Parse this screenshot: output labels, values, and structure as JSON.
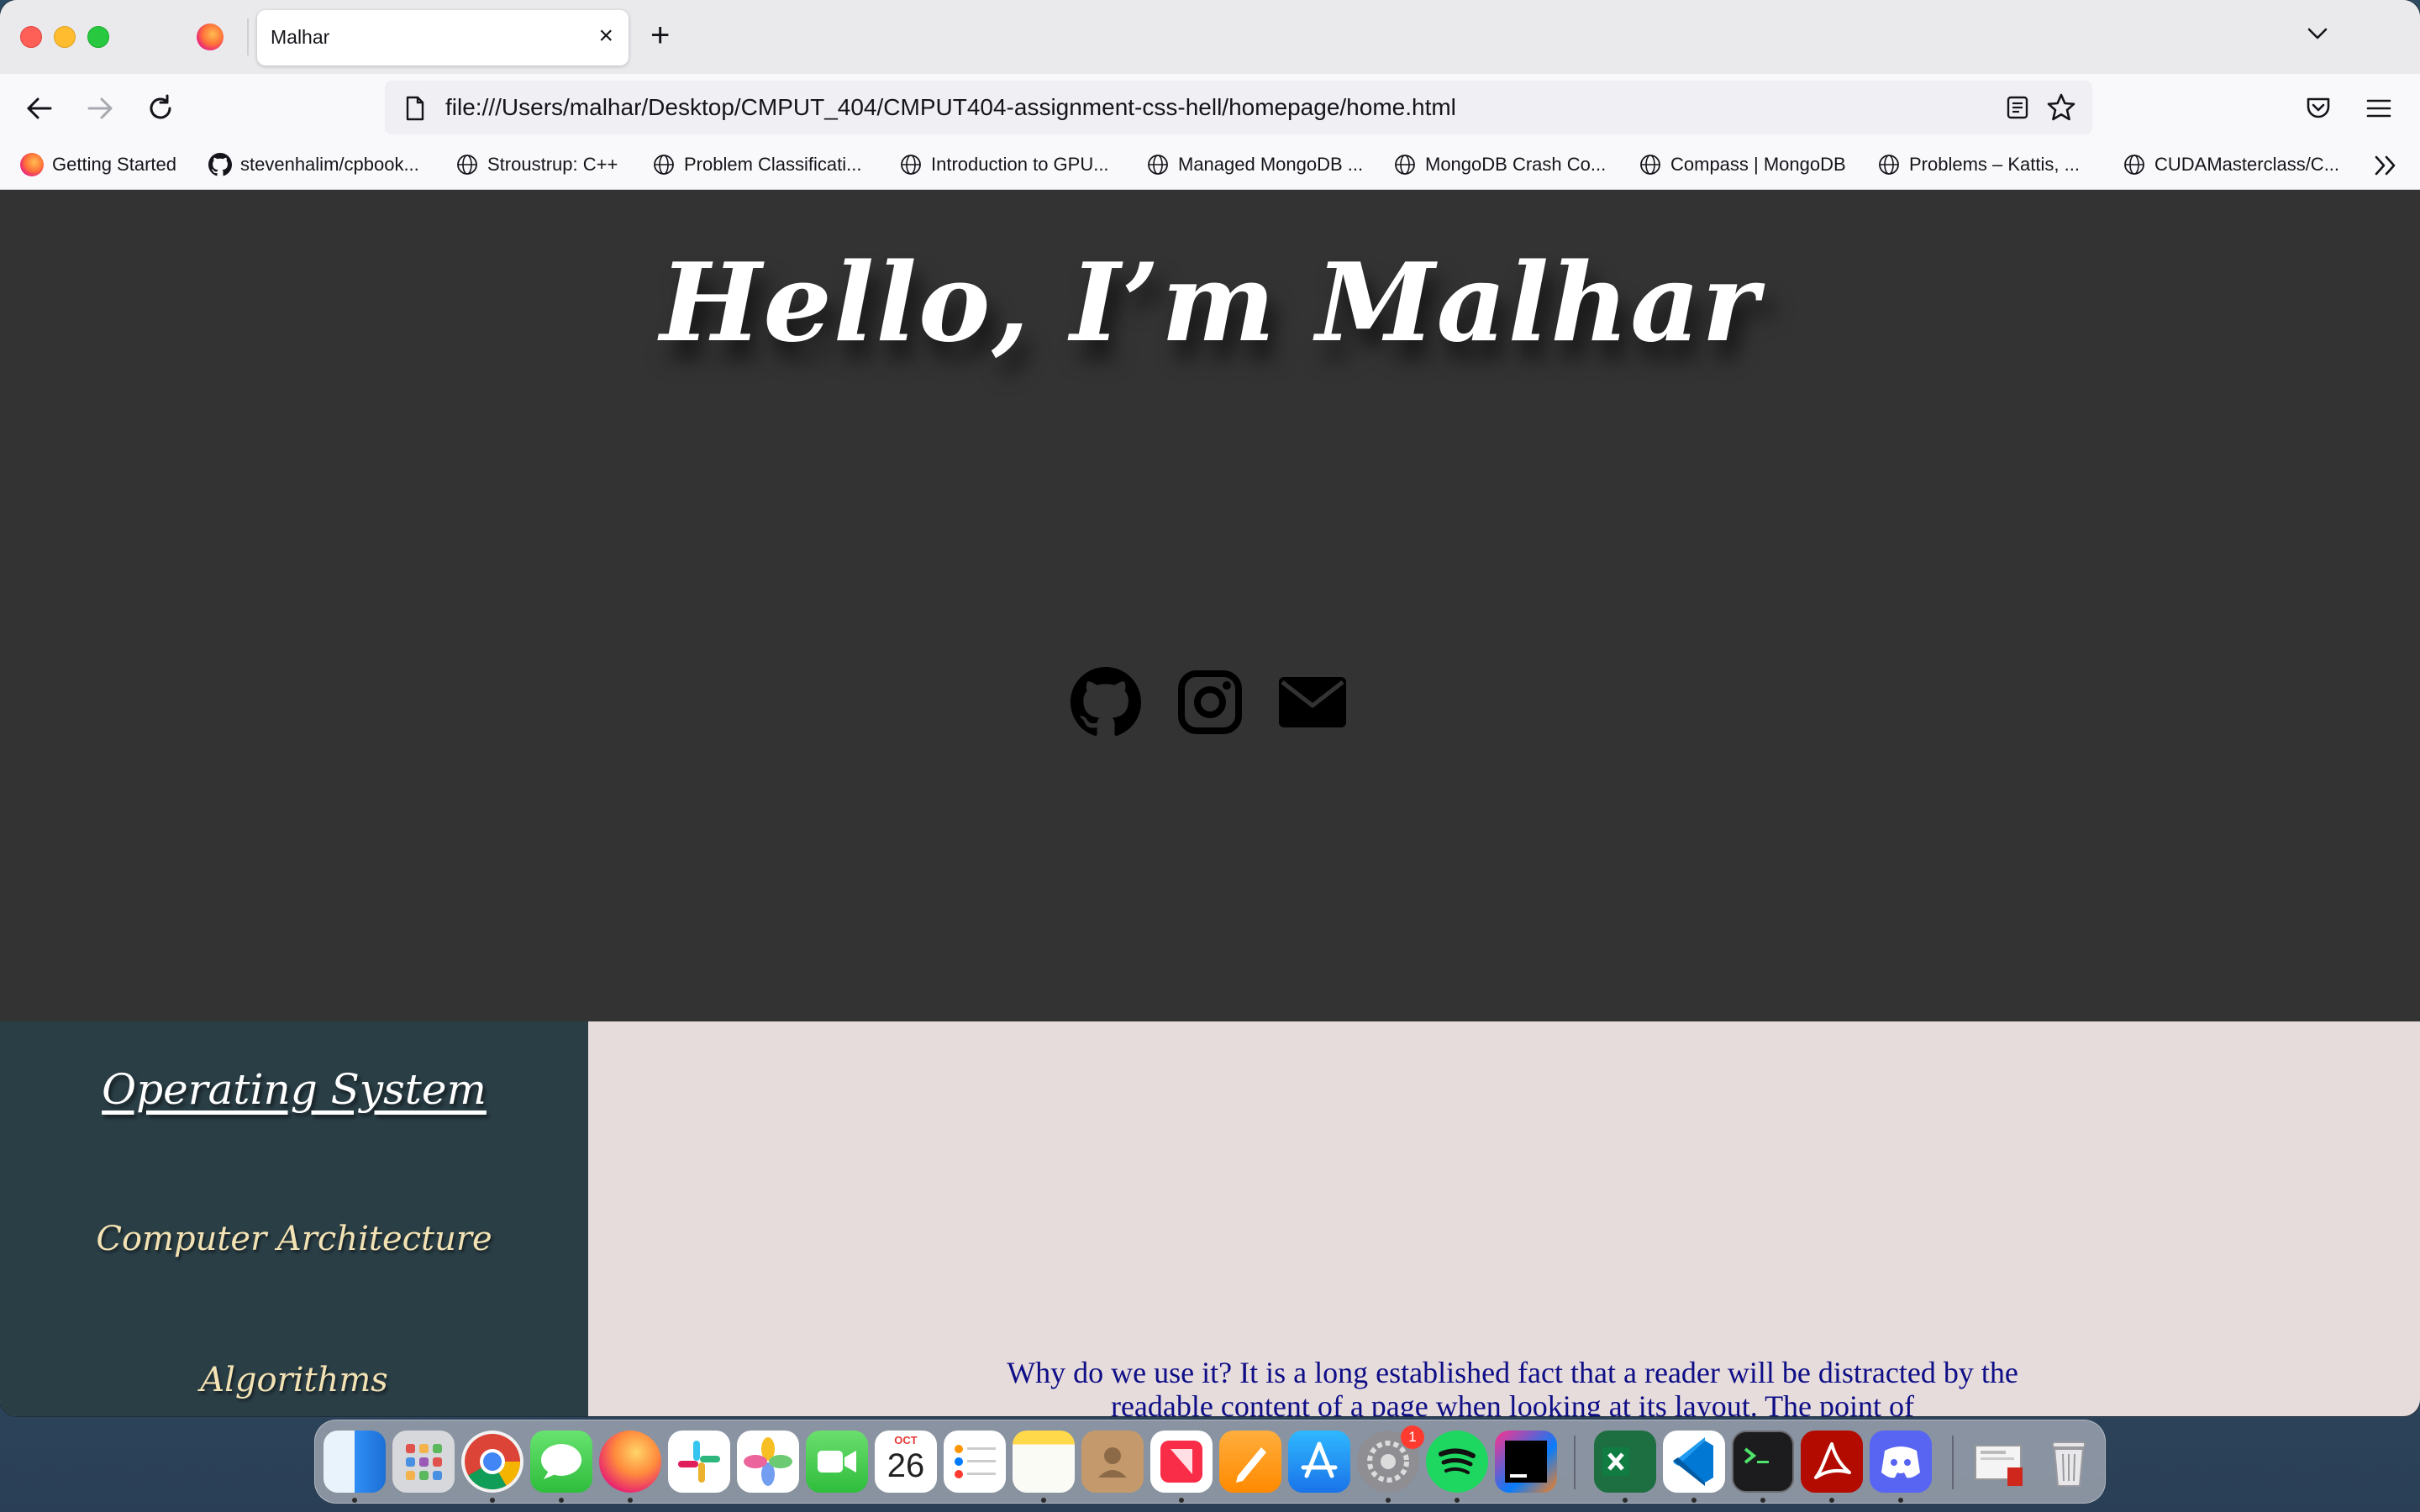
{
  "browser": {
    "tab_title": "Malhar",
    "tab_close": "×",
    "new_tab": "+",
    "url": "file:///Users/malhar/Desktop/CMPUT_404/CMPUT404-assignment-css-hell/homepage/home.html"
  },
  "bookmarks": [
    {
      "label": "Getting Started",
      "icon": "firefox-icon"
    },
    {
      "label": "stevenhalim/cpbook...",
      "icon": "github-icon"
    },
    {
      "label": "Stroustrup: C++",
      "icon": "globe-icon"
    },
    {
      "label": "Problem Classificati...",
      "icon": "globe-icon"
    },
    {
      "label": "Introduction to GPU...",
      "icon": "globe-icon"
    },
    {
      "label": "Managed MongoDB ...",
      "icon": "globe-icon"
    },
    {
      "label": "MongoDB Crash Co...",
      "icon": "globe-icon"
    },
    {
      "label": "Compass | MongoDB",
      "icon": "globe-icon"
    },
    {
      "label": "Problems – Kattis, ...",
      "icon": "globe-icon"
    },
    {
      "label": "CUDAMasterclass/C...",
      "icon": "globe-icon"
    }
  ],
  "hero": {
    "title": "Hello, I’m Malhar",
    "social_icons": [
      "github-icon",
      "instagram-icon",
      "envelope-icon"
    ]
  },
  "sidebar": {
    "items": [
      {
        "label": "Operating System",
        "active": true
      },
      {
        "label": "Computer Architecture",
        "active": false
      },
      {
        "label": "Algorithms",
        "active": false
      }
    ]
  },
  "content": {
    "text": "Why do we use it? It is a long established fact that a reader will be distracted by the readable content of a page when looking at its layout. The point of"
  },
  "dock": {
    "apps": [
      "Finder",
      "Launchpad",
      "Chrome",
      "Messages",
      "Firefox",
      "Slack",
      "Photos",
      "FaceTime",
      "Calendar",
      "Reminders",
      "Notes",
      "Contacts",
      "News",
      "Pages",
      "App Store",
      "System Preferences",
      "Spotify",
      "IntelliJ IDEA",
      "Excel",
      "VS Code",
      "Terminal",
      "Acrobat",
      "Discord",
      "Downloads",
      "Trash"
    ],
    "calendar_month": "OCT",
    "calendar_day": "26",
    "settings_badge": "1"
  },
  "colors": {
    "hero_bg": "#333333",
    "sidebar_bg": "#2a3e46",
    "sidebar_item": "#f3e2b3",
    "content_bg": "#e6dcdc",
    "content_text": "#0e0e86"
  }
}
